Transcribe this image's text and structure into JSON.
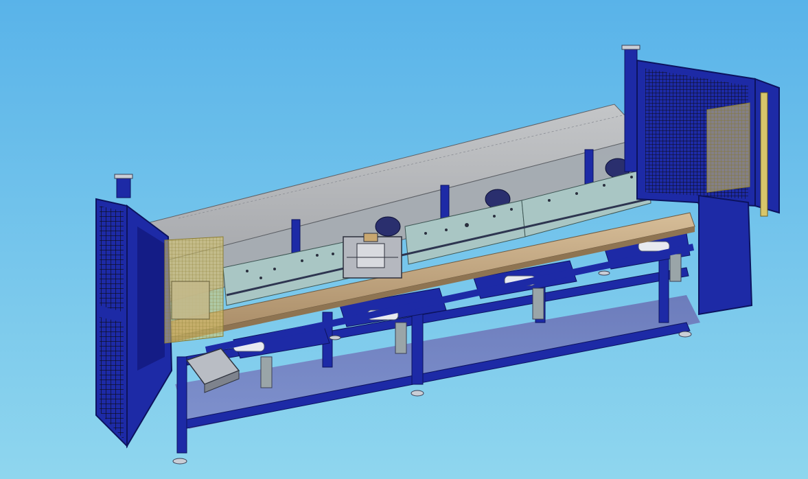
{
  "viewport": {
    "background_top": "#59b3e9",
    "background_bottom": "#8fd6ee"
  },
  "model": {
    "frame_color": "#1d2aa6",
    "frame_dark": "#121a78",
    "panel_color": "#b6b8bc",
    "rail_color": "#c9ad8a",
    "plate_color": "#a9c6c4",
    "safety_yellow": "#d8c66a",
    "mesh_color": "#0a0a0a"
  }
}
